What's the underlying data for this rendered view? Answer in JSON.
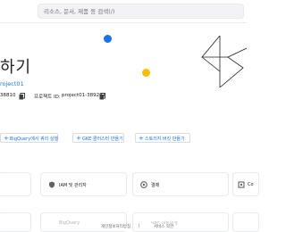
{
  "header": {
    "search_placeholder": "리소스, 문서, 제품 등 검색(/)"
  },
  "welcome": {
    "greeting": "하기",
    "project_name": "roject01",
    "project_number_value": "38810",
    "project_id_label": "프로젝트 ID:",
    "project_id_value": "project01-389201"
  },
  "actions": [
    {
      "label": "BigQuery에서 쿼리 실행"
    },
    {
      "label": "GKE 클러스터 만들기"
    },
    {
      "label": "스토리지 버킷 만들기"
    }
  ],
  "services": [
    {
      "label": "IAM 및 관리자",
      "icon": "shield-icon"
    },
    {
      "label": "결제",
      "icon": "billing-icon"
    },
    {
      "label": "Co",
      "icon": "compute-icon"
    }
  ],
  "services_row2": [
    {
      "label": "BigQuery"
    },
    {
      "label": "VPC 네트워크"
    }
  ],
  "footer": {
    "privacy": "개인정보처리방침",
    "separator": "|",
    "terms": "서비스 약관"
  },
  "colors": {
    "link_blue": "#1a73e8",
    "accent_yellow": "#fbbc04",
    "border": "#dadce0"
  }
}
